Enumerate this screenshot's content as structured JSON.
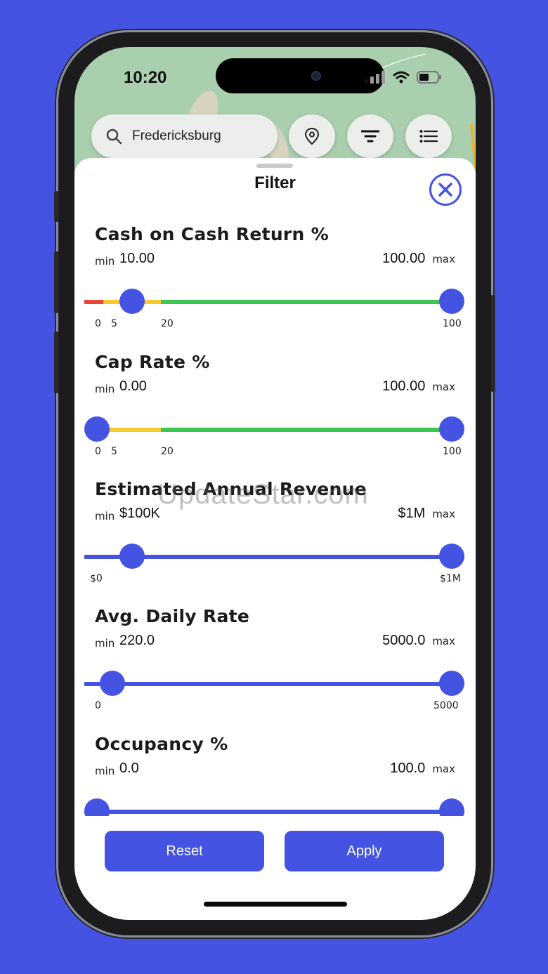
{
  "status": {
    "time": "10:20"
  },
  "search": {
    "value": "Fredericksburg"
  },
  "icons": {
    "search": "search-icon",
    "location": "map-pin-icon",
    "filter": "filter-icon",
    "list": "list-icon",
    "close": "close-icon"
  },
  "sheet": {
    "title": "Filter"
  },
  "filters": [
    {
      "title": "Cash on Cash Return %",
      "min_label": "min",
      "max_label": "max",
      "min": "10.00",
      "max": "100.00",
      "ticks": [
        "0",
        "5",
        "20",
        "100"
      ],
      "range": [
        0,
        100
      ],
      "low_value": 10,
      "high_value": 100
    },
    {
      "title": "Cap Rate %",
      "min_label": "min",
      "max_label": "max",
      "min": "0.00",
      "max": "100.00",
      "ticks": [
        "0",
        "5",
        "20",
        "100"
      ],
      "range": [
        0,
        100
      ],
      "low_value": 0,
      "high_value": 100
    },
    {
      "title": "Estimated Annual Revenue",
      "min_label": "min",
      "max_label": "max",
      "min": "$100K",
      "max": "$1M",
      "ticks": [
        "$0",
        "$1M"
      ],
      "range": [
        0,
        1000000
      ],
      "low_value": 100000,
      "high_value": 1000000
    },
    {
      "title": "Avg. Daily Rate",
      "min_label": "min",
      "max_label": "max",
      "min": "220.0",
      "max": "5000.0",
      "ticks": [
        "0",
        "5000"
      ],
      "range": [
        0,
        5000
      ],
      "low_value": 220,
      "high_value": 5000
    },
    {
      "title": "Occupancy %",
      "min_label": "min",
      "max_label": "max",
      "min": "0.0",
      "max": "100.0",
      "ticks": [],
      "range": [
        0,
        100
      ],
      "low_value": 0,
      "high_value": 100
    }
  ],
  "buttons": {
    "reset": "Reset",
    "apply": "Apply"
  },
  "watermark": "UpdateStar.com",
  "colors": {
    "accent": "#4453e2",
    "red": "#e8463a",
    "yellow": "#f6c92f",
    "green": "#3cc651"
  }
}
